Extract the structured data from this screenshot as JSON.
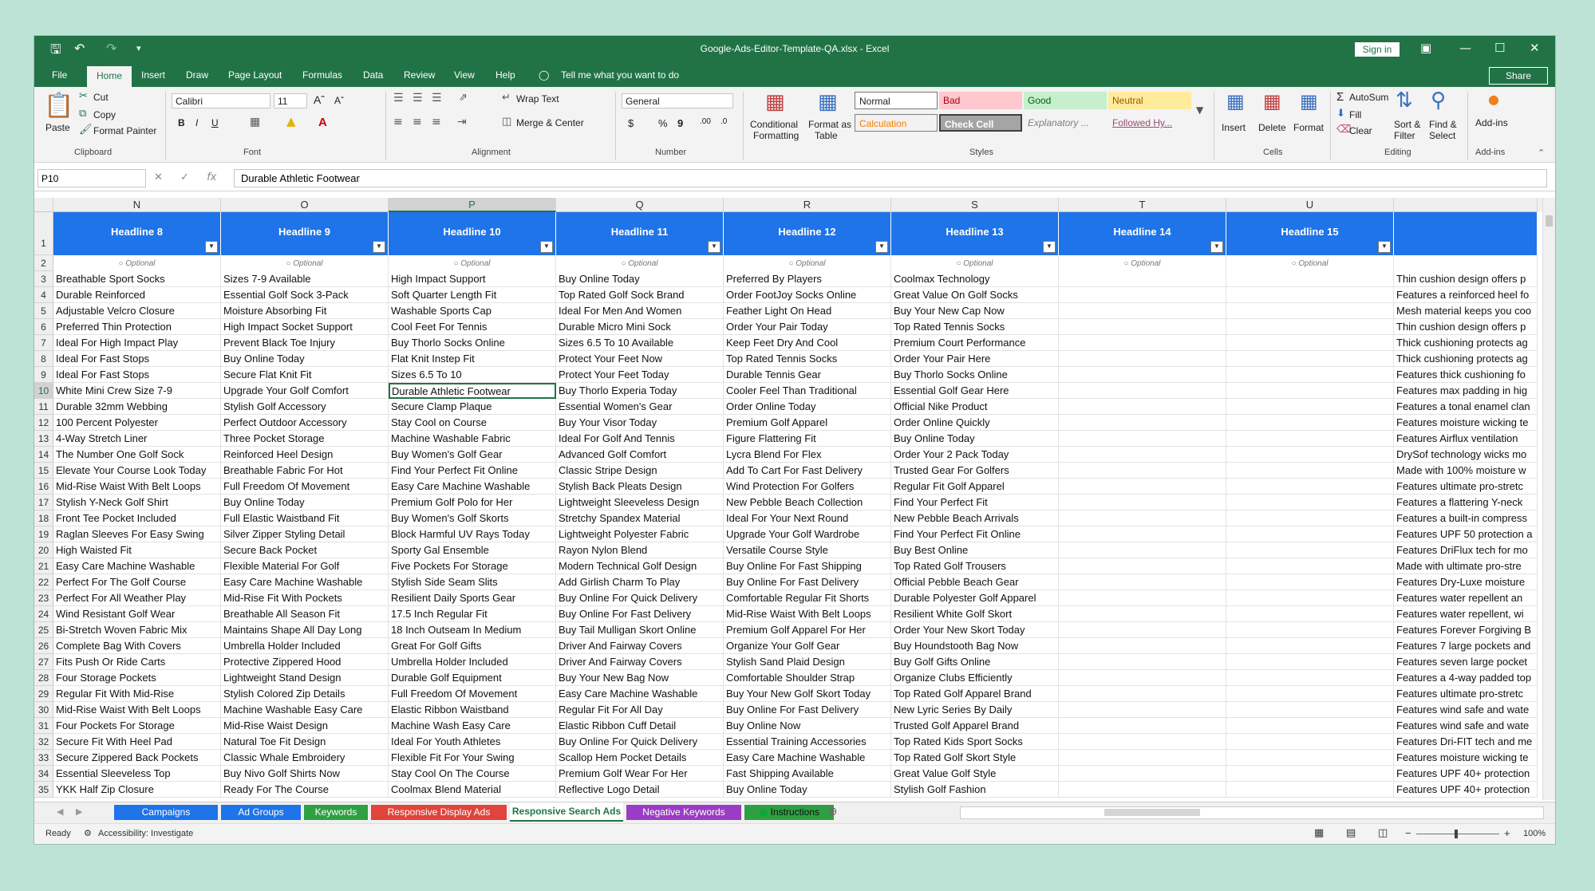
{
  "window": {
    "title": "Google-Ads-Editor-Template-QA.xlsx - Excel",
    "sign_in": "Sign in",
    "share": "Share"
  },
  "menu": [
    "File",
    "Home",
    "Insert",
    "Draw",
    "Page Layout",
    "Formulas",
    "Data",
    "Review",
    "View",
    "Help"
  ],
  "tell_me": "Tell me what you want to do",
  "ribbon": {
    "clipboard": {
      "paste": "Paste",
      "cut": "Cut",
      "copy": "Copy",
      "format_painter": "Format Painter",
      "group": "Clipboard"
    },
    "font": {
      "name": "Calibri",
      "size": "11",
      "group": "Font"
    },
    "alignment": {
      "wrap": "Wrap Text",
      "merge": "Merge & Center",
      "group": "Alignment"
    },
    "number": {
      "format": "General",
      "group": "Number"
    },
    "styles": {
      "conditional": "Conditional",
      "conditional2": "Formatting",
      "format_as": "Format as",
      "format_as2": "Table",
      "normal": "Normal",
      "bad": "Bad",
      "good": "Good",
      "neutral": "Neutral",
      "calculation": "Calculation",
      "check_cell": "Check Cell",
      "explanatory": "Explanatory ...",
      "followed": "Followed Hy...",
      "group": "Styles"
    },
    "cells": {
      "insert": "Insert",
      "delete": "Delete",
      "format": "Format",
      "group": "Cells"
    },
    "editing": {
      "autosum": "AutoSum",
      "fill": "Fill",
      "clear": "Clear",
      "sort": "Sort &",
      "sort2": "Filter",
      "find": "Find &",
      "find2": "Select",
      "group": "Editing"
    },
    "addins": {
      "label": "Add-ins",
      "group": "Add-ins"
    }
  },
  "formula_bar": {
    "name_box": "P10",
    "value": "Durable Athletic Footwear"
  },
  "columns": [
    "N",
    "O",
    "P",
    "Q",
    "R",
    "S",
    "T",
    "U",
    ""
  ],
  "selected_column": "P",
  "headers": [
    "Headline 8",
    "Headline 9",
    "Headline 10",
    "Headline 11",
    "Headline 12",
    "Headline 13",
    "Headline 14",
    "Headline 15",
    ""
  ],
  "optional_label": "Optional",
  "rows": [
    {
      "n": "3",
      "c": [
        "Breathable Sport Socks",
        "Sizes 7-9 Available",
        "High Impact Support",
        "Buy Online Today",
        "Preferred By Players",
        "Coolmax Technology",
        "",
        "",
        "Thin cushion design offers p"
      ]
    },
    {
      "n": "4",
      "c": [
        "Durable Reinforced",
        "Essential Golf Sock 3-Pack",
        "Soft Quarter Length Fit",
        "Top Rated Golf Sock Brand",
        "Order FootJoy Socks Online",
        "Great Value On Golf Socks",
        "",
        "",
        "Features a reinforced heel fo"
      ]
    },
    {
      "n": "5",
      "c": [
        "Adjustable Velcro Closure",
        "Moisture Absorbing Fit",
        "Washable Sports Cap",
        "Ideal For Men And Women",
        "Feather Light On Head",
        "Buy Your New Cap Now",
        "",
        "",
        "Mesh material keeps you coo"
      ]
    },
    {
      "n": "6",
      "c": [
        "Preferred Thin Protection",
        "High Impact Socket Support",
        "Cool Feet For Tennis",
        "Durable Micro Mini Sock",
        "Order Your Pair Today",
        "Top Rated Tennis Socks",
        "",
        "",
        "Thin cushion design offers p"
      ]
    },
    {
      "n": "7",
      "c": [
        "Ideal For High Impact Play",
        "Prevent Black Toe Injury",
        "Buy Thorlo Socks Online",
        "Sizes 6.5 To 10 Available",
        "Keep Feet Dry And Cool",
        "Premium Court Performance",
        "",
        "",
        "Thick cushioning protects ag"
      ]
    },
    {
      "n": "8",
      "c": [
        "Ideal For Fast Stops",
        "Buy Online Today",
        "Flat Knit Instep Fit",
        "Protect Your Feet Now",
        "Top Rated Tennis Socks",
        "Order Your Pair Here",
        "",
        "",
        "Thick cushioning protects ag"
      ]
    },
    {
      "n": "9",
      "c": [
        "Ideal For Fast Stops",
        "Secure Flat Knit Fit",
        "Sizes 6.5 To 10",
        "Protect Your Feet Today",
        "Durable Tennis Gear",
        "Buy Thorlo Socks Online",
        "",
        "",
        "Features thick cushioning fo"
      ]
    },
    {
      "n": "10",
      "c": [
        "White Mini Crew Size 7-9",
        "Upgrade Your Golf Comfort",
        "Durable Athletic Footwear",
        "Buy Thorlo Experia Today",
        "Cooler Feel Than Traditional",
        "Essential Golf Gear Here",
        "",
        "",
        "Features max padding in hig"
      ]
    },
    {
      "n": "11",
      "c": [
        "Durable 32mm Webbing",
        "Stylish Golf Accessory",
        "Secure Clamp Plaque",
        "Essential Women's Gear",
        "Order Online Today",
        "Official Nike Product",
        "",
        "",
        "Features a tonal enamel clan"
      ]
    },
    {
      "n": "12",
      "c": [
        "100 Percent Polyester",
        "Perfect Outdoor Accessory",
        "Stay Cool on Course",
        "Buy Your Visor Today",
        "Premium Golf Apparel",
        "Order Online Quickly",
        "",
        "",
        "Features moisture wicking te"
      ]
    },
    {
      "n": "13",
      "c": [
        "4-Way Stretch Liner",
        "Three Pocket Storage",
        "Machine Washable Fabric",
        "Ideal For Golf And Tennis",
        "Figure Flattering Fit",
        "Buy Online Today",
        "",
        "",
        "Features Airflux ventilation"
      ]
    },
    {
      "n": "14",
      "c": [
        "The Number One Golf Sock",
        "Reinforced Heel Design",
        "Buy Women's Golf Gear",
        "Advanced Golf Comfort",
        "Lycra Blend For Flex",
        "Order Your 2 Pack Today",
        "",
        "",
        "DrySof technology wicks mo"
      ]
    },
    {
      "n": "15",
      "c": [
        "Elevate Your Course Look Today",
        "Breathable Fabric For Hot",
        "Find Your Perfect Fit Online",
        "Classic Stripe Design",
        "Add To Cart For Fast Delivery",
        "Trusted Gear For Golfers",
        "",
        "",
        "Made with 100% moisture w"
      ]
    },
    {
      "n": "16",
      "c": [
        "Mid-Rise Waist With Belt Loops",
        "Full Freedom Of Movement",
        "Easy Care Machine Washable",
        "Stylish Back Pleats Design",
        "Wind Protection For Golfers",
        "Regular Fit Golf Apparel",
        "",
        "",
        "Features ultimate pro-stretc"
      ]
    },
    {
      "n": "17",
      "c": [
        "Stylish Y-Neck Golf Shirt",
        "Buy Online Today",
        "Premium Golf Polo for Her",
        "Lightweight Sleeveless Design",
        "New Pebble Beach Collection",
        "Find Your Perfect Fit",
        "",
        "",
        "Features a flattering Y-neck"
      ]
    },
    {
      "n": "18",
      "c": [
        "Front Tee Pocket Included",
        "Full Elastic Waistband Fit",
        "Buy Women's Golf Skorts",
        "Stretchy Spandex Material",
        "Ideal For Your Next Round",
        "New Pebble Beach Arrivals",
        "",
        "",
        "Features a built-in compress"
      ]
    },
    {
      "n": "19",
      "c": [
        "Raglan Sleeves For Easy Swing",
        "Silver Zipper Styling Detail",
        "Block Harmful UV Rays Today",
        "Lightweight Polyester Fabric",
        "Upgrade Your Golf Wardrobe",
        "Find Your Perfect Fit Online",
        "",
        "",
        "Features UPF 50 protection a"
      ]
    },
    {
      "n": "20",
      "c": [
        "High Waisted Fit",
        "Secure Back Pocket",
        "Sporty Gal Ensemble",
        "Rayon Nylon Blend",
        "Versatile Course Style",
        "Buy Best Online",
        "",
        "",
        "Features DriFlux tech for mo"
      ]
    },
    {
      "n": "21",
      "c": [
        "Easy Care Machine Washable",
        "Flexible Material For Golf",
        "Five Pockets For Storage",
        "Modern Technical Golf Design",
        "Buy Online For Fast Shipping",
        "Top Rated Golf Trousers",
        "",
        "",
        "Made with ultimate pro-stre"
      ]
    },
    {
      "n": "22",
      "c": [
        "Perfect For The Golf Course",
        "Easy Care Machine Washable",
        "Stylish Side Seam Slits",
        "Add Girlish Charm To Play",
        "Buy Online For Fast Delivery",
        "Official Pebble Beach Gear",
        "",
        "",
        "Features Dry-Luxe moisture"
      ]
    },
    {
      "n": "23",
      "c": [
        "Perfect For All Weather Play",
        "Mid-Rise Fit With Pockets",
        "Resilient Daily Sports Gear",
        "Buy Online For Quick Delivery",
        "Comfortable Regular Fit Shorts",
        "Durable Polyester Golf Apparel",
        "",
        "",
        "Features water repellent an"
      ]
    },
    {
      "n": "24",
      "c": [
        "Wind Resistant Golf Wear",
        "Breathable All Season Fit",
        "17.5 Inch Regular Fit",
        "Buy Online For Fast Delivery",
        "Mid-Rise Waist With Belt Loops",
        "Resilient White Golf Skort",
        "",
        "",
        "Features water repellent, wi"
      ]
    },
    {
      "n": "25",
      "c": [
        "Bi-Stretch Woven Fabric Mix",
        "Maintains Shape All Day Long",
        "18 Inch Outseam In Medium",
        "Buy Tail Mulligan Skort Online",
        "Premium Golf Apparel For Her",
        "Order Your New Skort Today",
        "",
        "",
        "Features Forever Forgiving B"
      ]
    },
    {
      "n": "26",
      "c": [
        "Complete Bag With Covers",
        "Umbrella Holder Included",
        "Great For Golf Gifts",
        "Driver And Fairway Covers",
        "Organize Your Golf Gear",
        "Buy Houndstooth Bag Now",
        "",
        "",
        "Features 7 large pockets and"
      ]
    },
    {
      "n": "27",
      "c": [
        "Fits Push Or Ride Carts",
        "Protective Zippered Hood",
        "Umbrella Holder Included",
        "Driver And Fairway Covers",
        "Stylish Sand Plaid Design",
        "Buy Golf Gifts Online",
        "",
        "",
        "Features seven large pocket"
      ]
    },
    {
      "n": "28",
      "c": [
        "Four Storage Pockets",
        "Lightweight Stand Design",
        "Durable Golf Equipment",
        "Buy Your New Bag Now",
        "Comfortable Shoulder Strap",
        "Organize Clubs Efficiently",
        "",
        "",
        "Features a 4-way padded top"
      ]
    },
    {
      "n": "29",
      "c": [
        "Regular Fit With Mid-Rise",
        "Stylish Colored Zip Details",
        "Full Freedom Of Movement",
        "Easy Care Machine Washable",
        "Buy Your New Golf Skort Today",
        "Top Rated Golf Apparel Brand",
        "",
        "",
        "Features ultimate pro-stretc"
      ]
    },
    {
      "n": "30",
      "c": [
        "Mid-Rise Waist With Belt Loops",
        "Machine Washable Easy Care",
        "Elastic Ribbon Waistband",
        "Regular Fit For All Day",
        "Buy Online For Fast Delivery",
        "New Lyric Series By Daily",
        "",
        "",
        "Features wind safe and wate"
      ]
    },
    {
      "n": "31",
      "c": [
        "Four Pockets For Storage",
        "Mid-Rise Waist Design",
        "Machine Wash Easy Care",
        "Elastic Ribbon Cuff Detail",
        "Buy Online Now",
        "Trusted Golf Apparel Brand",
        "",
        "",
        "Features wind safe and wate"
      ]
    },
    {
      "n": "32",
      "c": [
        "Secure Fit With Heel Pad",
        "Natural Toe Fit Design",
        "Ideal For Youth Athletes",
        "Buy Online For Quick Delivery",
        "Essential Training Accessories",
        "Top Rated Kids Sport Socks",
        "",
        "",
        "Features Dri-FIT tech and me"
      ]
    },
    {
      "n": "33",
      "c": [
        "Secure Zippered Back Pockets",
        "Classic Whale Embroidery",
        "Flexible Fit For Your Swing",
        "Scallop Hem Pocket Details",
        "Easy Care Machine Washable",
        "Top Rated Golf Skort Style",
        "",
        "",
        "Features moisture wicking te"
      ]
    },
    {
      "n": "34",
      "c": [
        "Essential Sleeveless Top",
        "Buy Nivo Golf Shirts Now",
        "Stay Cool On The Course",
        "Premium Golf Wear For Her",
        "Fast Shipping Available",
        "Great Value Golf Style",
        "",
        "",
        "Features UPF 40+ protection"
      ]
    },
    {
      "n": "35",
      "c": [
        "YKK Half Zip Closure",
        "Ready For The Course",
        "Coolmax Blend Material",
        "Reflective Logo Detail",
        "Buy Online Today",
        "Stylish Golf Fashion",
        "",
        "",
        "Features UPF 40+ protection"
      ]
    }
  ],
  "sheet_tabs": [
    {
      "label": "Campaigns",
      "color": "#1e74e8"
    },
    {
      "label": "Ad Groups",
      "color": "#1e74e8"
    },
    {
      "label": "Keywords",
      "color": "#2ea043"
    },
    {
      "label": "Responsive Display Ads",
      "color": "#e0443a"
    },
    {
      "label": "Responsive Search Ads",
      "color": "#fff",
      "active": true
    },
    {
      "label": "Negative Keywords",
      "color": "#9b3dc4"
    },
    {
      "label": "Instructions",
      "color": "#2ea043"
    }
  ],
  "status": {
    "ready": "Ready",
    "accessibility": "Accessibility: Investigate",
    "zoom": "100%"
  }
}
